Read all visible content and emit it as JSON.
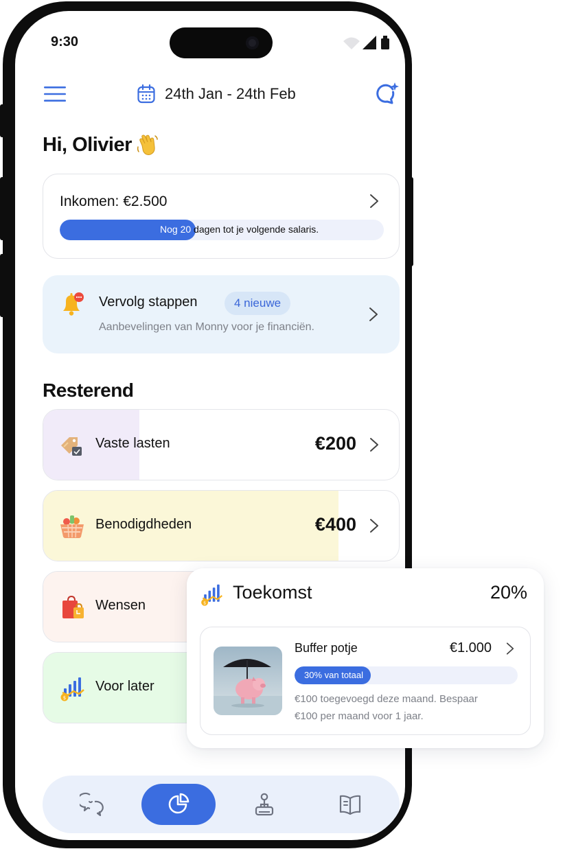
{
  "status_bar": {
    "time": "9:30"
  },
  "header": {
    "date_range": "24th Jan - 24th Feb",
    "menu_icon": "hamburger-menu-icon",
    "calendar_icon": "calendar-icon",
    "assistant_icon": "chat-sparkle-icon"
  },
  "greeting": {
    "text": "Hi, Olivier",
    "emoji_icon": "waving-hand-icon"
  },
  "income": {
    "label": "Inkomen: €2.500",
    "progress_prefix": "Nog 20",
    "progress_suffix": " dagen tot je volgende salaris.",
    "progress_fraction": 0.42
  },
  "next_steps": {
    "title": "Vervolg stappen",
    "badge": "4 nieuwe",
    "subtitle": "Aanbevelingen van Monny voor je financiën.",
    "icon": "notification-bell-icon"
  },
  "section_title": "Resterend",
  "budgets": [
    {
      "label": "Vaste lasten",
      "amount": "€200",
      "icon": "price-tag-icon",
      "fill_fraction": 0.27,
      "fill_color": "#f1ebf9"
    },
    {
      "label": "Benodigdheden",
      "amount": "€400",
      "icon": "grocery-basket-icon",
      "fill_fraction": 0.83,
      "fill_color": "#fbf7d8"
    },
    {
      "label": "Wensen",
      "amount": "",
      "icon": "shopping-bags-icon",
      "fill_fraction": 1.0,
      "fill_color": "#fdf3ef"
    },
    {
      "label": "Voor later",
      "amount": "",
      "icon": "growth-chart-coin-icon",
      "fill_fraction": 1.0,
      "fill_color": "#e6fbe6"
    }
  ],
  "future_card": {
    "title": "Toekomst",
    "percent": "20%",
    "icon": "growth-chart-coin-icon",
    "pot": {
      "name": "Buffer potje",
      "amount": "€1.000",
      "progress_label": "30% van totaal",
      "progress_fraction": 0.34,
      "description": "€100 toegevoegd deze maand. Bespaar €100 per maand voor 1 jaar.",
      "image": "piggy-bank-umbrella-photo"
    }
  },
  "bottom_nav": [
    {
      "name": "chat",
      "icon": "chat-bubbles-icon",
      "active": false
    },
    {
      "name": "overview",
      "icon": "pie-chart-icon",
      "active": true
    },
    {
      "name": "goals",
      "icon": "joystick-icon",
      "active": false
    },
    {
      "name": "learn",
      "icon": "open-book-icon",
      "active": false
    }
  ],
  "colors": {
    "accent": "#3b6de0",
    "muted_text": "#7d8088",
    "card_border": "#e2e3e8"
  }
}
